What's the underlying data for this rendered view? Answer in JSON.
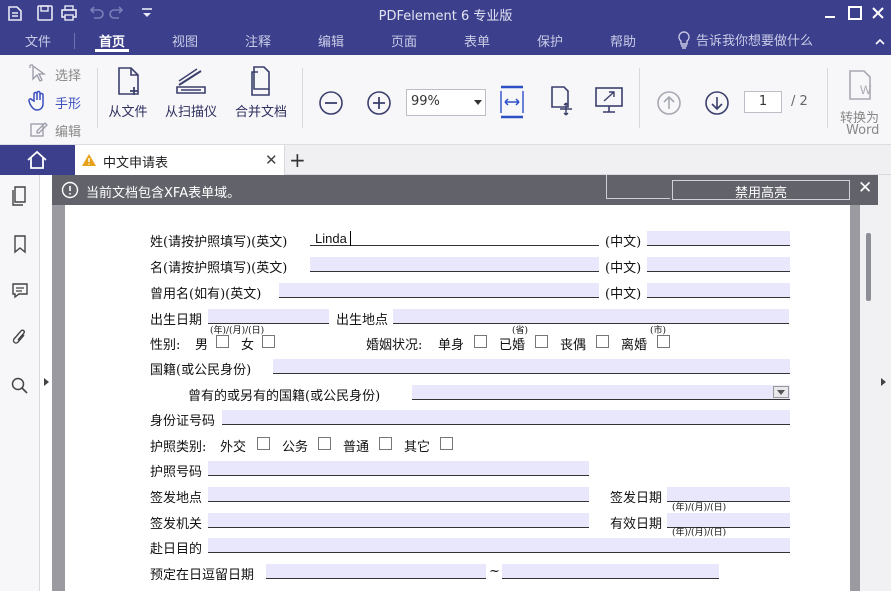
{
  "app": {
    "title": "PDFelement 6 专业版"
  },
  "menu": {
    "items": [
      "文件",
      "首页",
      "视图",
      "注释",
      "编辑",
      "页面",
      "表单",
      "保护",
      "帮助"
    ],
    "active": "首页",
    "ask_placeholder": "告诉我你想要做什么"
  },
  "ribbon": {
    "select": "选择",
    "hand": "手形",
    "edit": "编辑",
    "from_file": "从文件",
    "from_scanner": "从扫描仪",
    "combine": "合并文档",
    "zoom": "99%",
    "page_current": "1",
    "page_total": "/ 2",
    "convert_word_1": "转换为",
    "convert_word_2": "Word"
  },
  "tabs": {
    "doc_title": "中文申请表"
  },
  "xfa_bar": {
    "message": "当前文档包含XFA表单域。",
    "disable_button": "禁用高亮"
  },
  "form": {
    "surname_label": "姓(请按护照填写)(英文)",
    "surname_value": "Linda",
    "chinese_label_1": "(中文)",
    "given_label": "名(请按护照填写)(英文)",
    "chinese_label_2": "(中文)",
    "former_label": "曾用名(如有)(英文)",
    "chinese_label_3": "(中文)",
    "dob_label": "出生日期",
    "pob_label": "出生地点",
    "date_hint_1": "(年)/(月)/(日)",
    "gender_label": "性别:",
    "male": "男",
    "female": "女",
    "marital_label": "婚姻状况:",
    "single": "单身",
    "married": "已婚",
    "widowed": "丧偶",
    "divorced": "离婚",
    "prov_hint": "(省)",
    "city_hint": "(市)",
    "nationality_label": "国籍(或公民身份)",
    "other_nationality_label": "曾有的或另有的国籍(或公民身份)",
    "id_label": "身份证号码",
    "passport_type_label": "护照类别:",
    "diplomatic": "外交",
    "official": "公务",
    "ordinary": "普通",
    "other": "其它",
    "passport_no_label": "护照号码",
    "issue_place_label": "签发地点",
    "issue_date_label": "签发日期",
    "date_hint_2": "(年)/(月)/(日)",
    "issuer_label": "签发机关",
    "expiry_label": "有效日期",
    "date_hint_3": "(年)/(月)/(日)",
    "purpose_label": "赴日目的",
    "stay_label": "预定在日逗留日期",
    "tilde": "~"
  }
}
